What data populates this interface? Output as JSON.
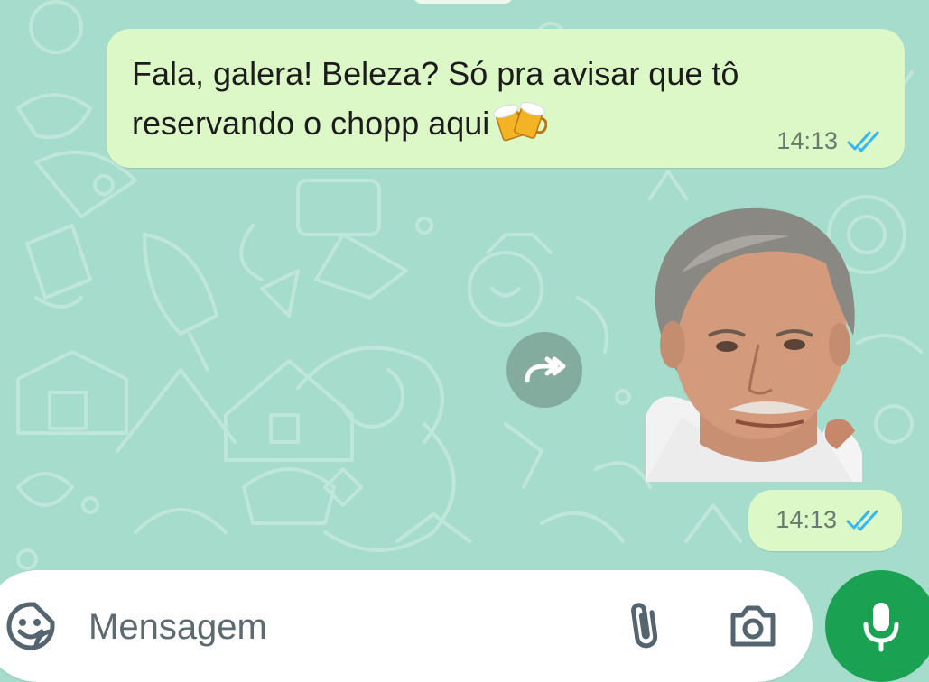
{
  "chat": {
    "messages": [
      {
        "text": "Fala, galera! Beleza? Só pra avisar que tô reservando o chopp aqui",
        "emoji": "beer-mugs-emoji",
        "time": "14:13",
        "status": "read"
      },
      {
        "type": "sticker",
        "sticker": "smiling-man-sticker",
        "time": "14:13",
        "status": "read"
      }
    ],
    "forward_icon": "forward-icon"
  },
  "composer": {
    "placeholder": "Mensagem",
    "value": "",
    "icons": [
      "sticker-icon",
      "attach-icon",
      "camera-icon",
      "mic-icon"
    ]
  },
  "colors": {
    "wallpaper": "#a6dccb",
    "outgoing_bubble": "#dcf8c6",
    "read_ticks": "#34b7f1",
    "mic_button": "#1aa252",
    "timestamp": "#6b7a6e"
  }
}
